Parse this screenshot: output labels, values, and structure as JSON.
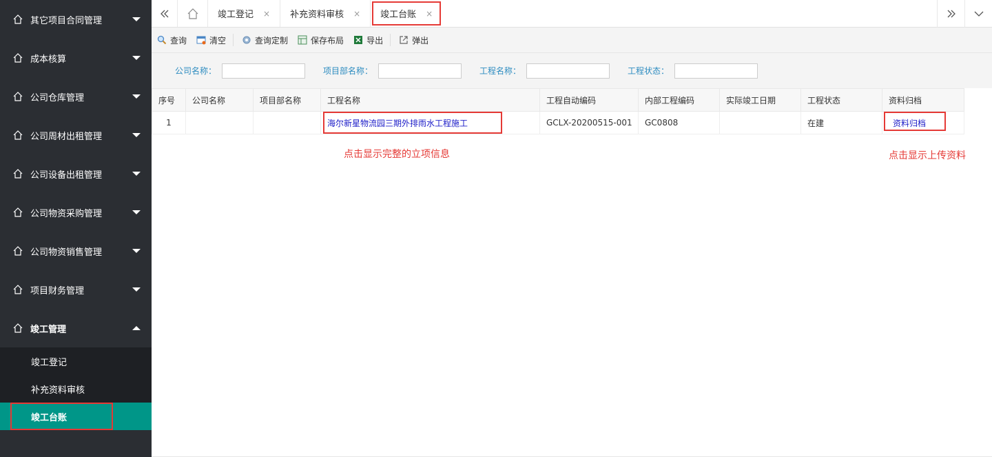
{
  "sidebar": {
    "menu": [
      {
        "label": "其它项目合同管理"
      },
      {
        "label": "成本核算"
      },
      {
        "label": "公司仓库管理"
      },
      {
        "label": "公司周材出租管理"
      },
      {
        "label": "公司设备出租管理"
      },
      {
        "label": "公司物资采购管理"
      },
      {
        "label": "公司物资销售管理"
      },
      {
        "label": "项目财务管理"
      },
      {
        "label": "竣工管理"
      }
    ],
    "submenu": [
      {
        "label": "竣工登记"
      },
      {
        "label": "补充资料审核"
      },
      {
        "label": "竣工台账"
      }
    ]
  },
  "tabs": [
    {
      "label": "竣工登记",
      "close": "×"
    },
    {
      "label": "补充资料审核",
      "close": "×"
    },
    {
      "label": "竣工台账",
      "close": "×"
    }
  ],
  "toolbar": {
    "query": "查询",
    "clear": "清空",
    "custom_query": "查询定制",
    "save_layout": "保存布局",
    "export": "导出",
    "popup": "弹出"
  },
  "search": {
    "company": "公司名称：",
    "dept": "项目部名称：",
    "project": "工程名称：",
    "status": "工程状态："
  },
  "table": {
    "headers": [
      "序号",
      "公司名称",
      "项目部名称",
      "工程名称",
      "工程自动编码",
      "内部工程编码",
      "实际竣工日期",
      "工程状态",
      "资料归档"
    ],
    "rows": [
      {
        "no": "1",
        "company": "",
        "dept": "",
        "project": "海尔新星物流园三期外排雨水工程施工",
        "auto_code": "GCLX-20200515-001",
        "internal_code": "GC0808",
        "finish_date": "",
        "status": "在建",
        "archive": "资料归档"
      }
    ]
  },
  "annotations": {
    "left": "点击显示完整的立项信息",
    "right": "点击显示上传资料"
  },
  "colors": {
    "sidebar_bg": "#2b2e33",
    "submenu_bg": "#1e2024",
    "active_green": "#009688",
    "highlight_red": "#e53935",
    "label_blue": "#2d8cc0"
  }
}
